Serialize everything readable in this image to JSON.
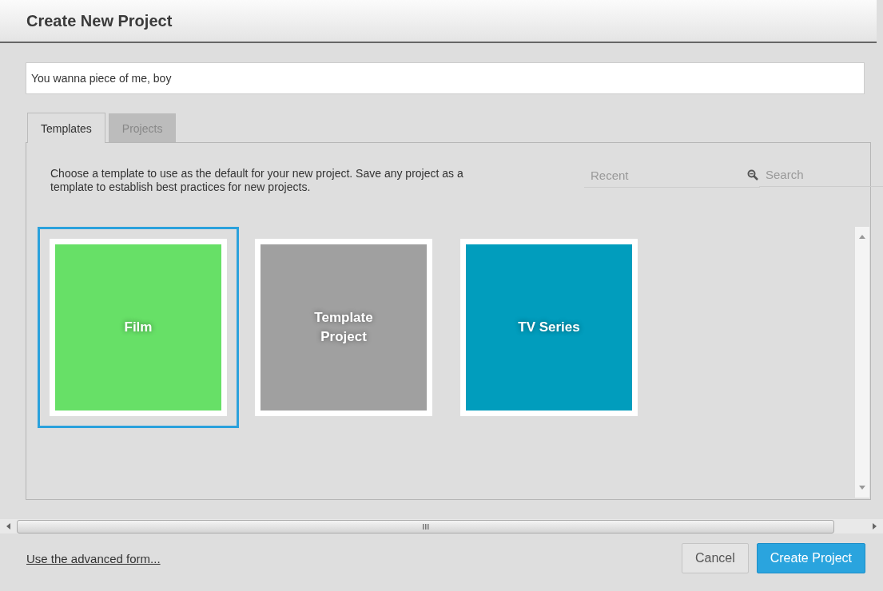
{
  "dialog": {
    "title": "Create New Project"
  },
  "name_field": {
    "value": "You wanna piece of me, boy"
  },
  "tabs": [
    {
      "label": "Templates",
      "selected": true
    },
    {
      "label": "Projects",
      "selected": false
    }
  ],
  "description": "Choose a template to use as the default for your new project. Save any project as a template to establish best practices for new projects.",
  "filter": {
    "placeholder": "Recent"
  },
  "search": {
    "placeholder": "Search"
  },
  "templates": [
    {
      "name": "Film",
      "color": "#67e067",
      "selected": true
    },
    {
      "name": "Template Project",
      "color": "#a0a0a0",
      "selected": false
    },
    {
      "name": "TV Series",
      "color": "#019dbd",
      "selected": false
    }
  ],
  "footer": {
    "link": "Use the advanced form...",
    "buttons": [
      {
        "label": "Cancel",
        "kind": "secondary"
      },
      {
        "label": "Create Project",
        "kind": "primary"
      }
    ]
  }
}
